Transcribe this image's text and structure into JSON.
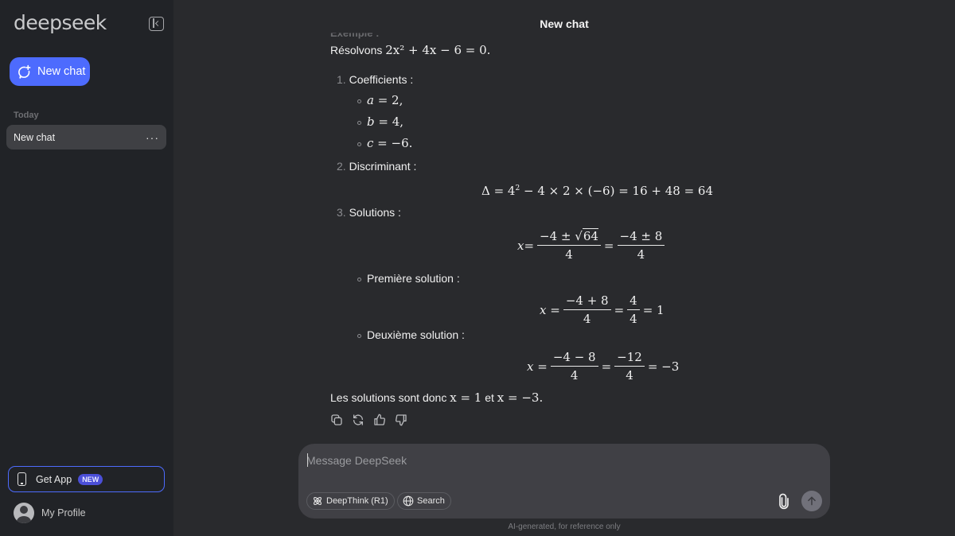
{
  "sidebar": {
    "logo": "deepseek",
    "new_chat_label": "New chat",
    "section_label": "Today",
    "chats": [
      {
        "title": "New chat",
        "menu": "···"
      }
    ],
    "get_app_label": "Get App",
    "get_app_badge": "NEW",
    "profile_label": "My Profile"
  },
  "header": {
    "title": "New chat"
  },
  "message": {
    "faded_heading": "Exemple :",
    "intro_text": "Résolvons",
    "intro_math": "2x² + 4x − 6 = 0.",
    "steps": [
      {
        "num": "1.",
        "label": "Coefficients :"
      },
      {
        "num": "2.",
        "label": "Discriminant :"
      },
      {
        "num": "3.",
        "label": "Solutions :"
      }
    ],
    "coefficients": [
      {
        "var": "a",
        "rest": " = 2,"
      },
      {
        "var": "b",
        "rest": " = 4,"
      },
      {
        "var": "c",
        "rest": " = −6."
      }
    ],
    "discriminant": {
      "delta": "Δ = 4",
      "exp": "2",
      "rest": " − 4 × 2 × (−6) = 16 + 48 = 64"
    },
    "general_solution": {
      "lhs": "x",
      "eq": " = ",
      "f1_num_a": "−4 ± ",
      "f1_num_sqrt": "64",
      "f1_den": "4",
      "f2_num": "−4 ± 8",
      "f2_den": "4"
    },
    "first_solution": {
      "label": "Première solution :",
      "lhs": "x",
      "f1_num": "−4 + 8",
      "f1_den": "4",
      "f2_num": "4",
      "f2_den": "4",
      "result": "= 1"
    },
    "second_solution": {
      "label": "Deuxième solution :",
      "lhs": "x",
      "f1_num": "−4 − 8",
      "f1_den": "4",
      "f2_num": "−12",
      "f2_den": "4",
      "result": "= −3"
    },
    "conclusion": {
      "text_a": "Les solutions sont donc ",
      "math_a": "x = 1",
      "text_b": " et ",
      "math_b": "x = −3."
    },
    "actions": [
      "copy-icon",
      "regenerate-icon",
      "thumbs-up-icon",
      "thumbs-down-icon"
    ]
  },
  "composer": {
    "placeholder": "Message DeepSeek",
    "deepthink_label": "DeepThink (R1)",
    "search_label": "Search"
  },
  "footer": {
    "disclaimer": "AI-generated, for reference only"
  },
  "colors": {
    "accent": "#4d6bfe",
    "sidebar_bg": "#212327",
    "main_bg": "#292a2d",
    "composer_bg": "#404045"
  }
}
